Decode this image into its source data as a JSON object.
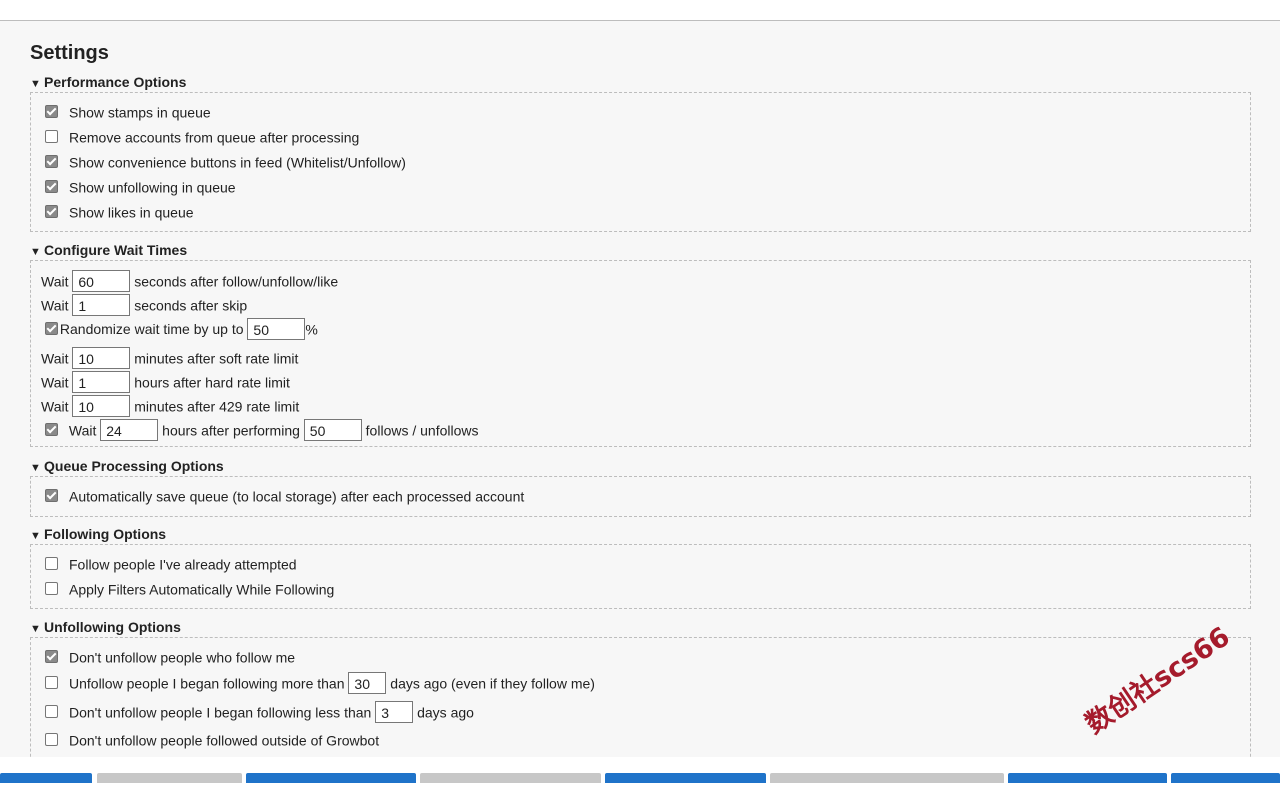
{
  "page": {
    "title": "Settings"
  },
  "performance": {
    "header": "Performance Options",
    "items": [
      {
        "label": "Show stamps in queue",
        "checked": true
      },
      {
        "label": "Remove accounts from queue after processing",
        "checked": false
      },
      {
        "label": "Show convenience buttons in feed (Whitelist/Unfollow)",
        "checked": true
      },
      {
        "label": "Show unfollowing in queue",
        "checked": true
      },
      {
        "label": "Show likes in queue",
        "checked": true
      }
    ]
  },
  "wait": {
    "header": "Configure Wait Times",
    "wait_word": "Wait",
    "follow": {
      "value": "60",
      "suffix": "seconds after follow/unfollow/like"
    },
    "skip": {
      "value": "1",
      "suffix": "seconds after skip"
    },
    "randomize": {
      "checked": true,
      "label": "Randomize wait time by up to",
      "value": "50",
      "suffix": "%"
    },
    "soft": {
      "value": "10",
      "suffix": "minutes after soft rate limit"
    },
    "hard": {
      "value": "1",
      "suffix": "hours after hard rate limit"
    },
    "limit429": {
      "value": "10",
      "suffix": "minutes after 429 rate limit"
    },
    "perform": {
      "checked": true,
      "hours": "24",
      "middle": "hours after performing",
      "count": "50",
      "suffix": "follows / unfollows"
    }
  },
  "queue": {
    "header": "Queue Processing Options",
    "items": [
      {
        "label": "Automatically save queue (to local storage) after each processed account",
        "checked": true
      }
    ]
  },
  "following": {
    "header": "Following Options",
    "items": [
      {
        "label": "Follow people I've already attempted",
        "checked": false
      },
      {
        "label": "Apply Filters Automatically While Following",
        "checked": false
      }
    ]
  },
  "unfollowing": {
    "header": "Unfollowing Options",
    "dont_unfollow_followers": {
      "label": "Don't unfollow people who follow me",
      "checked": true
    },
    "older_than": {
      "label": "Unfollow people I began following more than",
      "value": "30",
      "suffix": "days ago (even if they follow me)",
      "checked": false
    },
    "newer_than": {
      "label": "Don't unfollow people I began following less than",
      "value": "3",
      "suffix": "days ago",
      "checked": false
    },
    "outside": {
      "label": "Don't unfollow people followed outside of Growbot",
      "checked": false
    }
  },
  "watermark": "数创社scs66",
  "colors": {
    "tab_active": "#1f73c9",
    "tab_inactive": "#c7c7c7",
    "checkbox_checked": "#8a8a8a"
  },
  "tabs": [
    {
      "state": "active"
    },
    {
      "state": "inactive"
    },
    {
      "state": "active"
    },
    {
      "state": "inactive"
    },
    {
      "state": "active"
    },
    {
      "state": "inactive"
    },
    {
      "state": "active"
    },
    {
      "state": "active"
    }
  ]
}
